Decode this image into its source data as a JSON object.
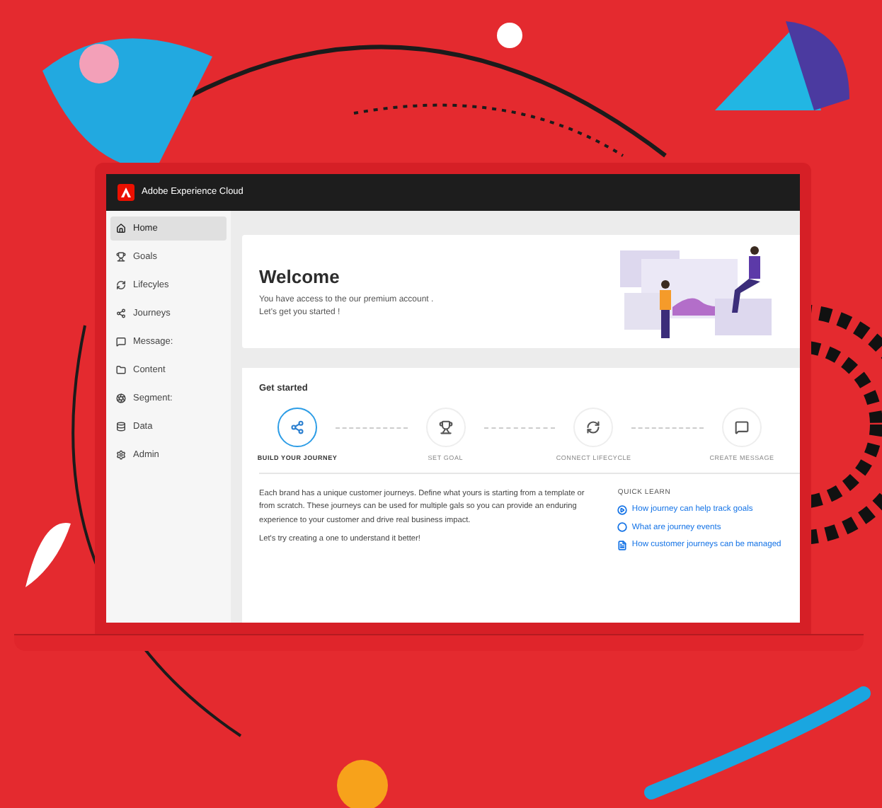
{
  "window": {
    "title": "Adobe Experience Cloud"
  },
  "sidebar": {
    "items": [
      {
        "label": "Home",
        "selected": true
      },
      {
        "label": "Goals",
        "selected": false
      },
      {
        "label": "Lifecyles",
        "selected": false
      },
      {
        "label": "Journeys",
        "selected": false
      },
      {
        "label": "Message:",
        "selected": false
      },
      {
        "label": "Content",
        "selected": false
      },
      {
        "label": "Segment:",
        "selected": false
      },
      {
        "label": "Data",
        "selected": false
      },
      {
        "label": "Admin",
        "selected": false
      }
    ]
  },
  "welcome": {
    "title": "Welcome",
    "lines": [
      "You have access to the our premium account .",
      "Let's get you started !"
    ]
  },
  "get_started": {
    "title": "Get started",
    "steps": [
      {
        "label": "BUILD YOUR JOURNEY",
        "selected": true
      },
      {
        "label": "SET GOAL",
        "selected": false
      },
      {
        "label": "CONNECT LIFECYCLE",
        "selected": false
      },
      {
        "label": "CREATE MESSAGE",
        "selected": false
      }
    ],
    "description": [
      "Each brand has a unique customer journeys. Define what yours is starting from a template or from scratch. These journeys can be used for multiple gals so you can provide an enduring experience to your customer and drive real business impact.",
      "Let's try creating a one to understand it better!"
    ],
    "quick_learn": {
      "title": "QUICK LEARN",
      "links": [
        {
          "kind": "video",
          "label": "How journey can help track goals"
        },
        {
          "kind": "event",
          "label": "What are journey events"
        },
        {
          "kind": "doc",
          "label": "How customer journeys can be managed"
        }
      ]
    }
  }
}
